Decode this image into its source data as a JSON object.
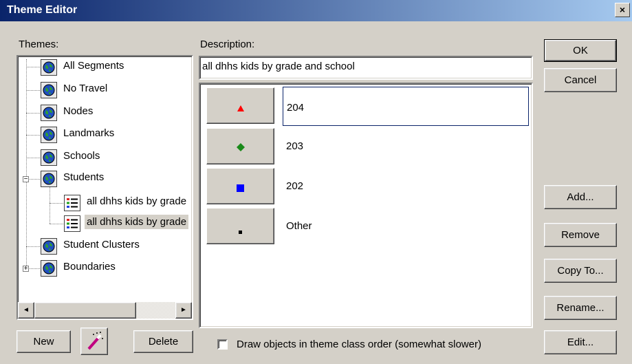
{
  "window": {
    "title": "Theme Editor",
    "close_glyph": "×"
  },
  "themes": {
    "label": "Themes:",
    "items": [
      {
        "label": "All Segments",
        "icon": "globe-icon"
      },
      {
        "label": "No Travel",
        "icon": "globe-icon"
      },
      {
        "label": "Nodes",
        "icon": "globe-icon"
      },
      {
        "label": "Landmarks",
        "icon": "globe-icon"
      },
      {
        "label": "Schools",
        "icon": "globe-icon"
      },
      {
        "label": "Students",
        "icon": "globe-icon",
        "expander": "−"
      },
      {
        "label": "all dhhs kids by grade",
        "icon": "theme-list-icon"
      },
      {
        "label": "all dhhs kids by grade",
        "icon": "theme-list-icon",
        "selected": true
      },
      {
        "label": "Student Clusters",
        "icon": "globe-icon"
      },
      {
        "label": "Boundaries",
        "icon": "globe-icon",
        "expander": "+"
      }
    ],
    "scroll_left": "◄",
    "scroll_right": "►"
  },
  "buttons": {
    "new": "New",
    "delete": "Delete",
    "ok": "OK",
    "cancel": "Cancel",
    "add": "Add...",
    "remove": "Remove",
    "copy_to": "Copy To...",
    "rename": "Rename...",
    "edit": "Edit..."
  },
  "description": {
    "label": "Description:",
    "value": "all dhhs kids by grade and school"
  },
  "classes": [
    {
      "label": "204",
      "symbol": "red-triangle-icon",
      "color": "#ff0000",
      "selected": true
    },
    {
      "label": "203",
      "symbol": "green-diamond-icon",
      "color": "#1a8a1a"
    },
    {
      "label": "202",
      "symbol": "blue-square-icon",
      "color": "#0000ff"
    },
    {
      "label": "Other",
      "symbol": "black-square-icon",
      "color": "#000000"
    }
  ],
  "draw_order": {
    "label": "Draw objects in theme class order (somewhat slower)",
    "checked": false
  }
}
